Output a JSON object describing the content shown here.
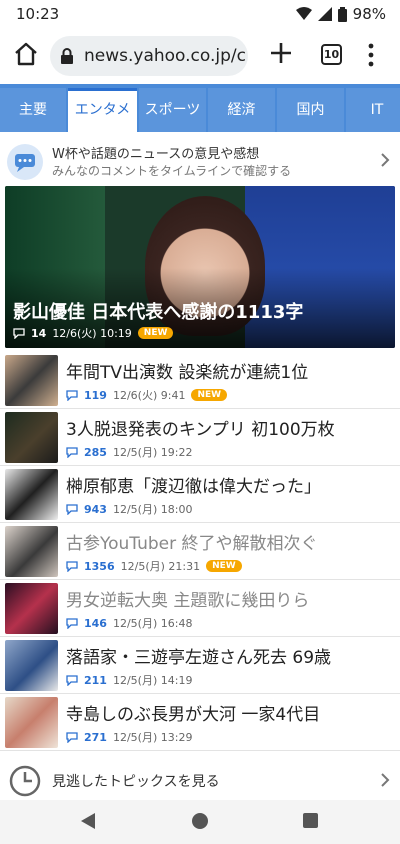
{
  "status": {
    "time": "10:23",
    "battery": "98%"
  },
  "browser": {
    "url": "news.yahoo.co.jp/c",
    "tab_count": "10"
  },
  "categories": [
    {
      "label": "主要",
      "active": false
    },
    {
      "label": "エンタメ",
      "active": true
    },
    {
      "label": "スポーツ",
      "active": false
    },
    {
      "label": "経済",
      "active": false
    },
    {
      "label": "国内",
      "active": false
    },
    {
      "label": "IT",
      "active": false
    }
  ],
  "banner": {
    "line1": "W杯や話題のニュースの意見や感想",
    "line2": "みんなのコメントをタイムラインで確認する"
  },
  "hero": {
    "title": "影山優佳 日本代表へ感謝の1113字",
    "comments": "14",
    "date": "12/6(火) 10:19",
    "badge": "NEW"
  },
  "articles": [
    {
      "title": "年間TV出演数 設楽統が連続1位",
      "comments": "119",
      "date": "12/6(火) 9:41",
      "badge": "NEW",
      "read": false
    },
    {
      "title": "3人脱退発表のキンプリ 初100万枚",
      "comments": "285",
      "date": "12/5(月) 19:22",
      "badge": "",
      "read": false
    },
    {
      "title": "榊原郁恵「渡辺徹は偉大だった」",
      "comments": "943",
      "date": "12/5(月) 18:00",
      "badge": "",
      "read": false
    },
    {
      "title": "古参YouTuber 終了や解散相次ぐ",
      "comments": "1356",
      "date": "12/5(月) 21:31",
      "badge": "NEW",
      "read": true
    },
    {
      "title": "男女逆転大奥 主題歌に幾田りら",
      "comments": "146",
      "date": "12/5(月) 16:48",
      "badge": "",
      "read": true
    },
    {
      "title": "落語家・三遊亭左遊さん死去 69歳",
      "comments": "211",
      "date": "12/5(月) 14:19",
      "badge": "",
      "read": false
    },
    {
      "title": "寺島しのぶ長男が大河 一家4代目",
      "comments": "271",
      "date": "12/5(月) 13:29",
      "badge": "",
      "read": false
    }
  ],
  "missed": {
    "label": "見逃したトピックスを見る"
  },
  "icons": {
    "home": "home-icon",
    "lock": "lock-icon",
    "plus": "new-tab-icon",
    "menu": "overflow-menu-icon",
    "comment": "comment-icon",
    "chevron": "chevron-right-icon",
    "clock": "clock-icon"
  },
  "colors": {
    "accent": "#2a6fd0",
    "tabbar": "#4a8ad8",
    "badge": "#f6a700"
  }
}
